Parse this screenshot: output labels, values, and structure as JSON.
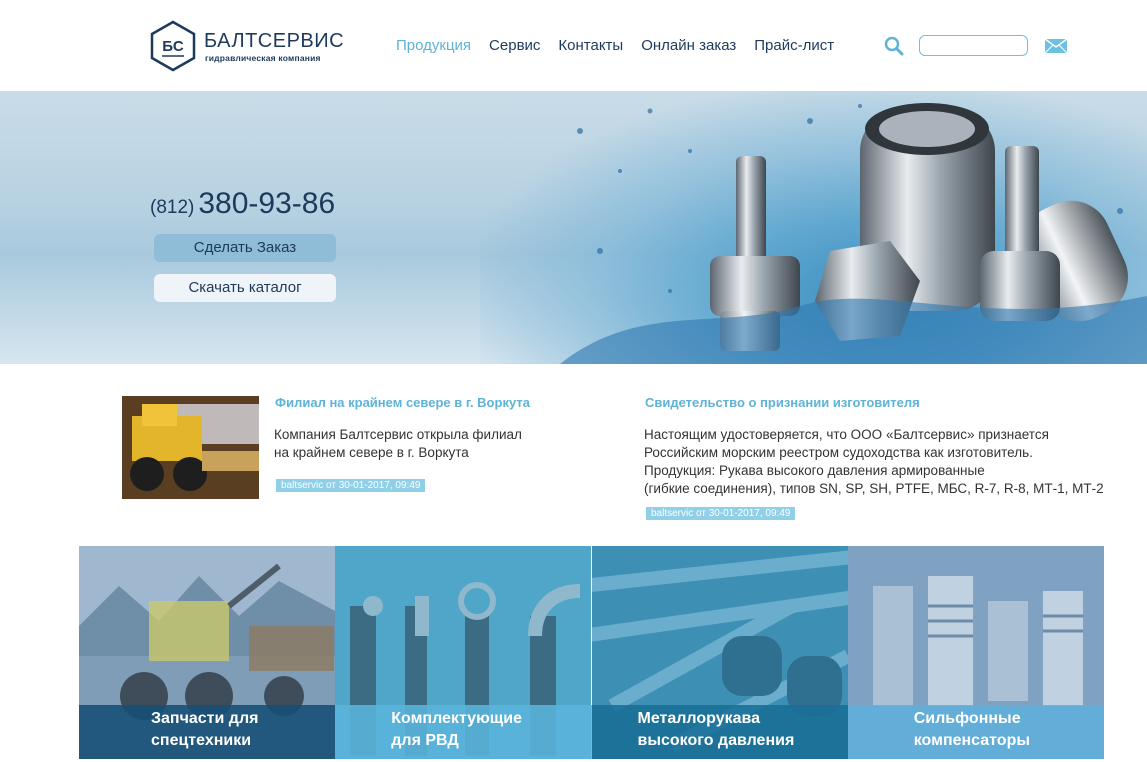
{
  "header": {
    "logo_name": "БАЛТСЕРВИС",
    "logo_sub": "гидравлическая компания",
    "logo_letters": "БС",
    "nav": [
      "Продукция",
      "Сервис",
      "Контакты",
      "Онлайн заказ",
      "Прайс-лист"
    ],
    "active_nav": "Продукция",
    "search_placeholder": "",
    "icons": [
      "search-icon",
      "mail-icon"
    ]
  },
  "hero": {
    "phone_code": "(812)",
    "phone_number": "380-93-86",
    "order_button": "Сделать Заказ",
    "catalog_button": "Скачать каталог"
  },
  "news": [
    {
      "title": "Филиал на крайнем севере в г. Воркута",
      "lines": [
        "Компания Балтсервис открыла филиал",
        "на крайнем севере в г. Воркута"
      ],
      "meta": "baltservic от 30-01-2017, 09:49"
    },
    {
      "title": "Свидетельство о признании изготовителя",
      "lines": [
        "Настоящим удостоверяется, что ООО «Балтсервис» признается",
        "Российским морским реестром судоходства как изготовитель.",
        "Продукция: Рукава высокого давления армированные",
        "(гибкие соединения), типов SN, SP, SH, PTFE, МБС, R-7, R-8, МТ-1, МТ-2"
      ],
      "meta": "baltservic от 30-01-2017, 09:49"
    }
  ],
  "tiles": [
    {
      "line1": "Запчасти для",
      "line2": "спецтехники"
    },
    {
      "line1": "Комплектующие",
      "line2": "для РВД"
    },
    {
      "line1": "Металлорукава",
      "line2": "высокого давления"
    },
    {
      "line1": "Сильфонные",
      "line2": "компенсаторы"
    }
  ],
  "colors": {
    "brand_dark": "#1d3a5c",
    "accent": "#5eb3d6",
    "order_button": "#8fbcd7"
  }
}
